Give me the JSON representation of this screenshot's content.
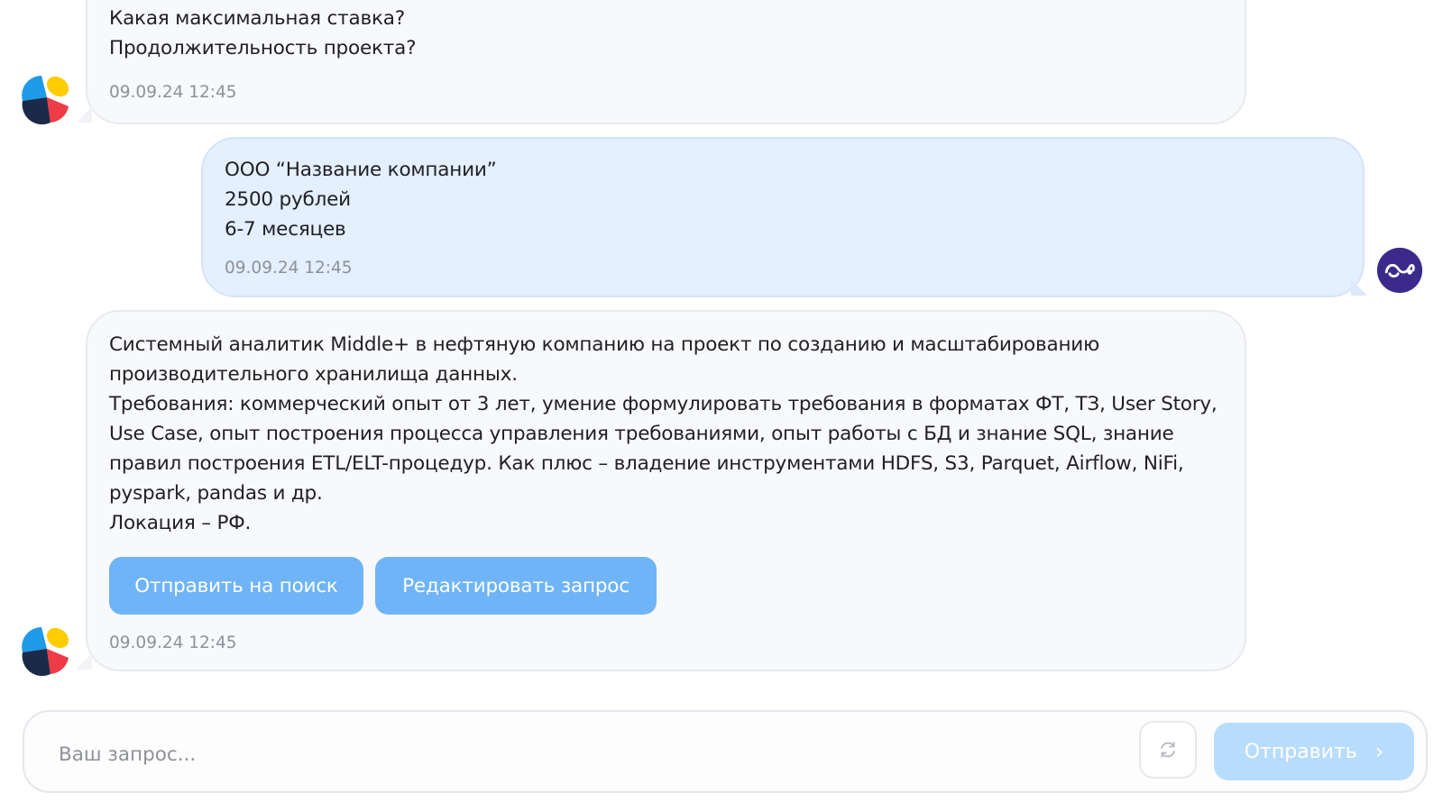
{
  "messages": [
    {
      "role": "bot",
      "lines": [
        "Какая максимальная ставка?",
        "Продолжительность проекта?"
      ],
      "time": "09.09.24 12:45"
    },
    {
      "role": "user",
      "lines": [
        "ООО “Название компании”",
        "2500 рублей",
        "6-7 месяцев"
      ],
      "time": "09.09.24 12:45"
    },
    {
      "role": "bot",
      "lines": [
        "Системный аналитик Middle+ в нефтяную компанию на проект по созданию и масштабированию",
        "производительного хранилища данных.",
        "Требования: коммерческий опыт от 3 лет, умение формулировать требования в форматах ФТ, ТЗ, User Story,",
        "Use Case, опыт построения процесса управления требованиями, опыт работы с БД и знание SQL, знание",
        "правил построения ETL/ELT-процедур. Как плюс – владение инструментами HDFS, S3, Parquet, Airflow, NiFi,",
        "pyspark, pandas и др.",
        "Локация – РФ."
      ],
      "buttons": [
        "Отправить на поиск",
        "Редактировать запрос"
      ],
      "time": "09.09.24 12:45"
    }
  ],
  "composer": {
    "placeholder": "Ваш запрос...",
    "send_label": "Отправить"
  },
  "colors": {
    "bot_bubble": "#f8f9fc",
    "user_bubble": "#e4efff",
    "action_button": "#6fb4f7",
    "send_button_disabled": "#b8dcfc",
    "user_avatar": "#3b2a8c"
  },
  "icons": {
    "bot_avatar": "colorful-logo-icon",
    "user_avatar": "user-avatar-icon",
    "reset": "refresh-icon",
    "send": "chevron-right-icon"
  }
}
